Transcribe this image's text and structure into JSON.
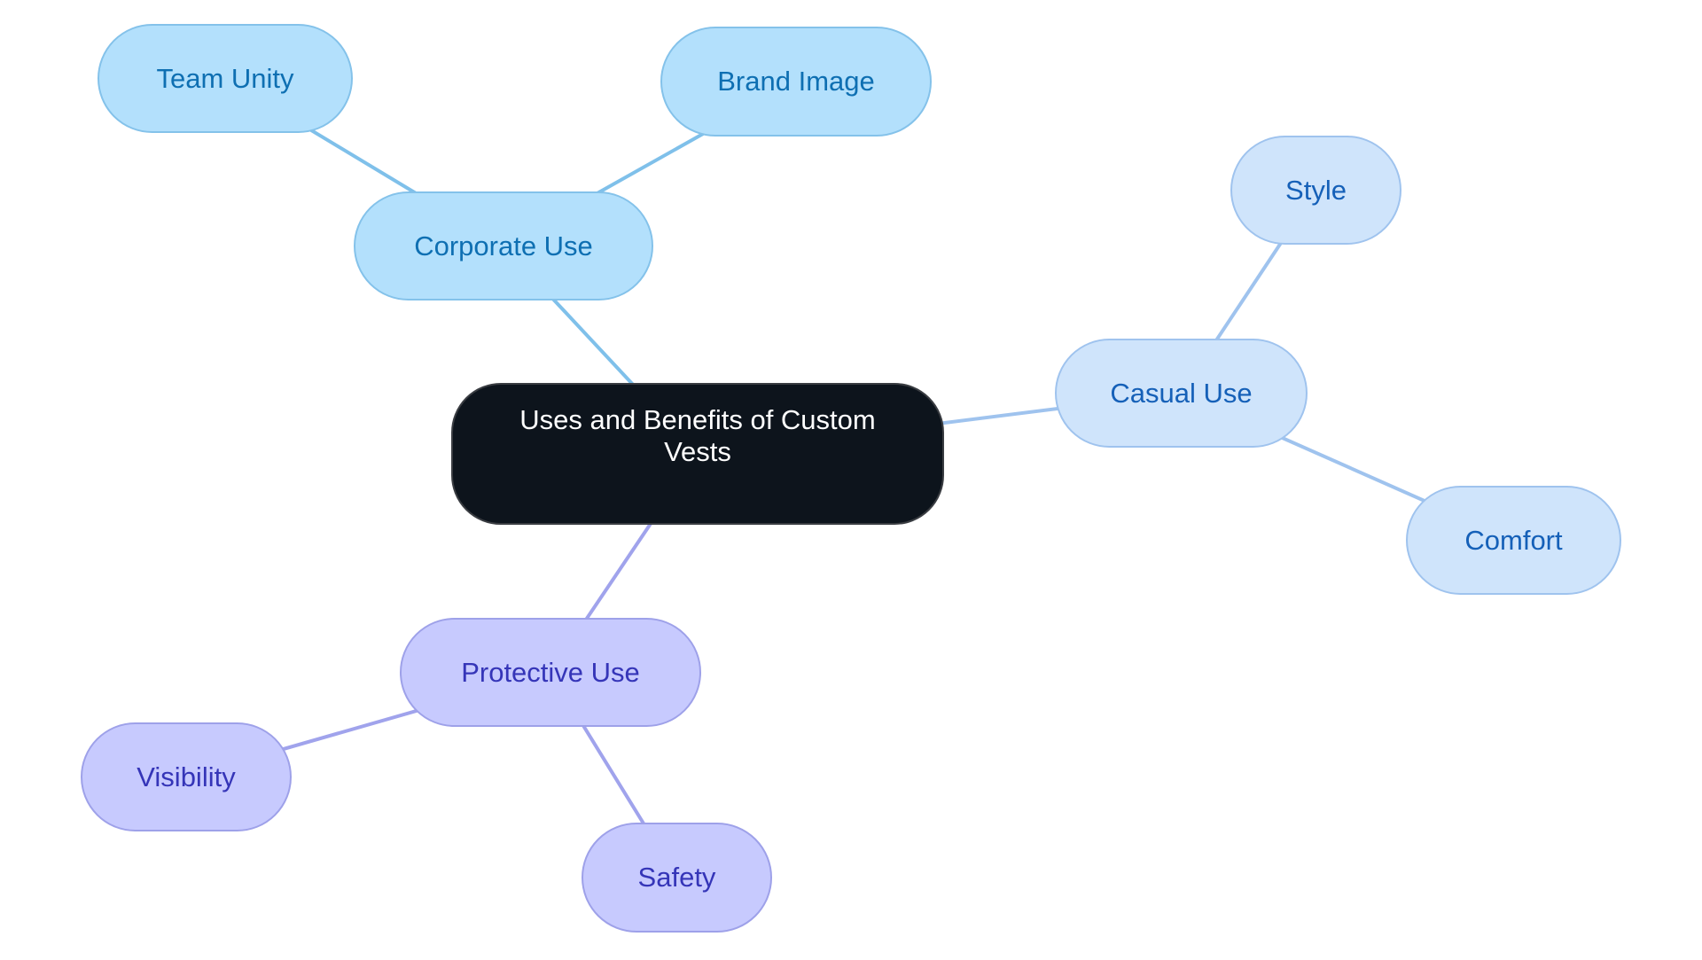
{
  "diagram": {
    "type": "mind-map",
    "root": {
      "id": "root",
      "label": "Uses and Benefits of Custom Vests",
      "theme": "dark"
    },
    "branches": [
      {
        "id": "corporate",
        "label": "Corporate Use",
        "theme": "sky",
        "children": [
          {
            "id": "team-unity",
            "label": "Team Unity"
          },
          {
            "id": "brand-image",
            "label": "Brand Image"
          }
        ]
      },
      {
        "id": "casual",
        "label": "Casual Use",
        "theme": "light-blue",
        "children": [
          {
            "id": "style",
            "label": "Style"
          },
          {
            "id": "comfort",
            "label": "Comfort"
          }
        ]
      },
      {
        "id": "protective",
        "label": "Protective Use",
        "theme": "lavender",
        "children": [
          {
            "id": "visibility",
            "label": "Visibility"
          },
          {
            "id": "safety",
            "label": "Safety"
          }
        ]
      }
    ]
  },
  "themes": {
    "dark": {
      "fill": "#0d141c",
      "border": "#3a3d42",
      "text": "#ffffff",
      "edge": "#7fc0ea"
    },
    "sky": {
      "fill": "#b3e0fc",
      "border": "#84c2ea",
      "text": "#0e6fb2",
      "edge": "#7fc0ea"
    },
    "light-blue": {
      "fill": "#cfe4fb",
      "border": "#9fc3ee",
      "text": "#1560b8",
      "edge": "#9fc3ee"
    },
    "lavender": {
      "fill": "#c7cafe",
      "border": "#9ea1e9",
      "text": "#3535b8",
      "edge": "#a0a3ec"
    }
  }
}
